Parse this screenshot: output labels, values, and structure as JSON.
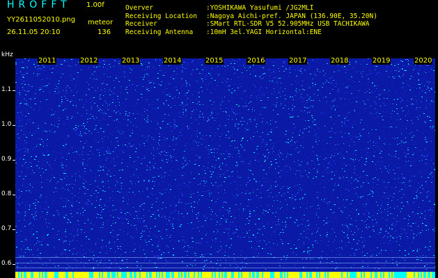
{
  "app": {
    "name": "HROFFT",
    "version": "1.00f"
  },
  "file": {
    "name": "YY2611052010.png",
    "type": "meteor",
    "datetime": "26.11.05 20:10",
    "count": "136"
  },
  "station": [
    {
      "key": "Overver",
      "value": ":YOSHIKAWA Yasufumi /JG2MLI"
    },
    {
      "key": "Receiving Location",
      "value": ":Nagoya Aichi-pref. JAPAN (136.90E, 35.20N)"
    },
    {
      "key": "Receiver",
      "value": ":SMart RTL-SDR V5 52.905MHz USB TACHIKAWA"
    },
    {
      "key": "Receiving Antenna",
      "value": ":10mH 3el.YAGI Horizontal:ENE"
    }
  ],
  "axis": {
    "unit": "kHz",
    "ticks": [
      "1.1",
      "1.0",
      "0.9",
      "0.8",
      "0.7",
      "0.6"
    ],
    "minutes": [
      "2011",
      "2012",
      "2013",
      "2014",
      "2015",
      "2016",
      "2017",
      "2018",
      "2019",
      "2020"
    ]
  },
  "colors": {
    "noise_bg": "#0a1aa6",
    "noise_hi": "#00ffff",
    "label_yellow": "#ffff00",
    "title_cyan": "#00ffff"
  }
}
